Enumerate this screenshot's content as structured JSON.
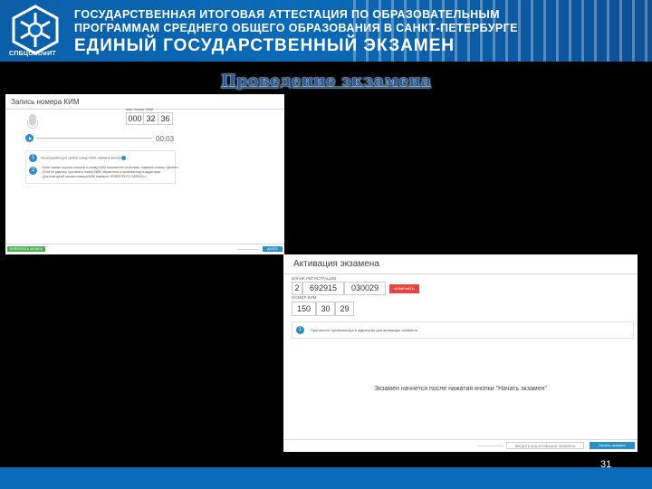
{
  "banner": {
    "line1": "ГОСУДАРСТВЕННАЯ ИТОГОВАЯ АТТЕСТАЦИЯ ПО ОБРАЗОВАТЕЛЬНЫМ",
    "line2": "ПРОГРАММАМ СРЕДНЕГО ОБЩЕГО ОБРАЗОВАНИЯ В САНКТ-ПЕТЕРБУРГЕ",
    "line3": "ЕДИНЫЙ ГОСУДАРСТВЕННЫЙ ЭКЗАМЕН",
    "logo_text": "СПБЦОКОиИТ"
  },
  "slide": {
    "title": "Проведение экзамена",
    "page_number": "31"
  },
  "panel1": {
    "title": "Запись номера КИМ",
    "kim_label": "ваш номер КИМ",
    "kim_parts": [
      "000",
      "32",
      "36"
    ],
    "time": "00:03",
    "steps": [
      {
        "num": "1",
        "text": "Прослушайте для записи номер КИМ, нажмите кнопку"
      },
      {
        "num": "2",
        "lines": [
          "- Если запись хорошо слышна и номер КИМ произнесен отчетливо, нажмите кнопку «Далее».",
          "- Если не удалось прочитать номер КИМ, обратитесь к организатору в аудитории.",
          "- Для повторной записи номера КИМ нажмите «ПОВТОРИТЬ ЗАПИСЬ»."
        ]
      }
    ],
    "repeat_button": "ПОВТОРИТЬ ЗАПИСЬ",
    "next_button": "ДАЛЕЕ"
  },
  "panel2": {
    "title": "Активация экзамена",
    "reg_label": "БЛАНК РЕГИСТРАЦИИ",
    "reg_parts": [
      "2",
      "692915",
      "030029"
    ],
    "change_button": "ИЗМЕНИТЬ",
    "kim_label": "НОМЕР КИМ",
    "kim_parts": [
      "150",
      "30",
      "29"
    ],
    "hint_num": "1",
    "hint_text": "Пригласите организатора в аудитории для активации экзамена",
    "message": "Экзамен начнется после нажатия кнопки \"Начать экзамен\"",
    "code_placeholder": "ВВЕДИТЕ КОД АКТИВАЦИИ ЭКЗАМЕНА",
    "start_button": "Начать экзамен"
  }
}
